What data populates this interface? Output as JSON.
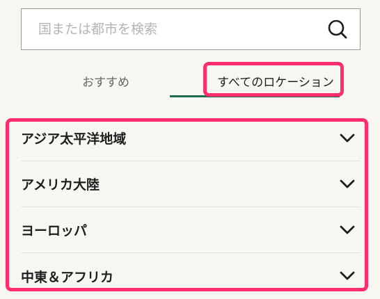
{
  "search": {
    "placeholder": "国または都市を検索",
    "value": "",
    "icon": "search-icon"
  },
  "tabs": [
    {
      "label": "おすすめ",
      "active": false
    },
    {
      "label": "すべてのロケーション",
      "active": true
    }
  ],
  "regions": [
    {
      "label": "アジア太平洋地域",
      "icon": "chevron-down-icon"
    },
    {
      "label": "アメリカ大陸",
      "icon": "chevron-down-icon"
    },
    {
      "label": "ヨーロッパ",
      "icon": "chevron-down-icon"
    },
    {
      "label": "中東＆アフリカ",
      "icon": "chevron-down-icon"
    }
  ],
  "colors": {
    "background": "#f7f6f1",
    "accent": "#1a6b52",
    "highlight": "#ff2d6b"
  }
}
